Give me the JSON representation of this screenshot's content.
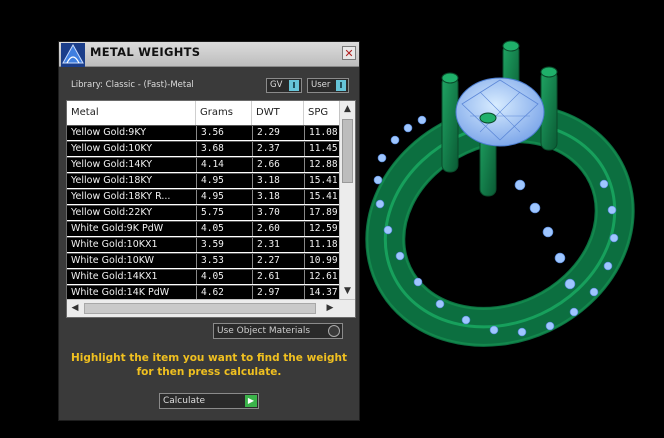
{
  "window": {
    "title": "METAL WEIGHTS",
    "close_glyph": "✕"
  },
  "library": {
    "label": "Library: Classic - (Fast)-Metal",
    "toggles": [
      {
        "label": "GV",
        "knob": "I"
      },
      {
        "label": "User",
        "knob": "I"
      }
    ]
  },
  "table": {
    "columns": [
      "Metal",
      "Grams",
      "DWT",
      "SPG"
    ],
    "rows": [
      [
        "Yellow Gold:9KY",
        "3.56",
        "2.29",
        "11.08"
      ],
      [
        "Yellow Gold:10KY",
        "3.68",
        "2.37",
        "11.45"
      ],
      [
        "Yellow Gold:14KY",
        "4.14",
        "2.66",
        "12.88"
      ],
      [
        "Yellow Gold:18KY",
        "4.95",
        "3.18",
        "15.41"
      ],
      [
        "Yellow Gold:18KY R...",
        "4.95",
        "3.18",
        "15.41"
      ],
      [
        "Yellow Gold:22KY",
        "5.75",
        "3.70",
        "17.89"
      ],
      [
        "White Gold:9K PdW",
        "4.05",
        "2.60",
        "12.59"
      ],
      [
        "White Gold:10KX1",
        "3.59",
        "2.31",
        "11.18"
      ],
      [
        "White Gold:10KW",
        "3.53",
        "2.27",
        "10.99"
      ],
      [
        "White Gold:14KX1",
        "4.05",
        "2.61",
        "12.61"
      ],
      [
        "White Gold:14K PdW",
        "4.62",
        "2.97",
        "14.37"
      ]
    ],
    "scroll": {
      "up": "▲",
      "down": "▼",
      "left": "◀",
      "right": "▶"
    }
  },
  "use_object_materials": {
    "label": "Use Object Materials",
    "checked": false
  },
  "hint": {
    "line1": "Highlight the item you want to find the weight",
    "line2": "for then press calculate."
  },
  "calculate": {
    "label": "Calculate",
    "arrow": "▶"
  },
  "colors": {
    "hint": "#f0c020",
    "metal": "#0f8a4f",
    "gem": "#9ec6ff",
    "toggle_accent": "#66c4d8",
    "calc_accent": "#3bb34a"
  },
  "icons": {
    "logo": "app-logo-icon",
    "close": "close-icon",
    "scroll_up": "scroll-up-icon",
    "scroll_down": "scroll-down-icon",
    "scroll_left": "scroll-left-icon",
    "scroll_right": "scroll-right-icon",
    "calculate": "play-arrow-icon"
  }
}
